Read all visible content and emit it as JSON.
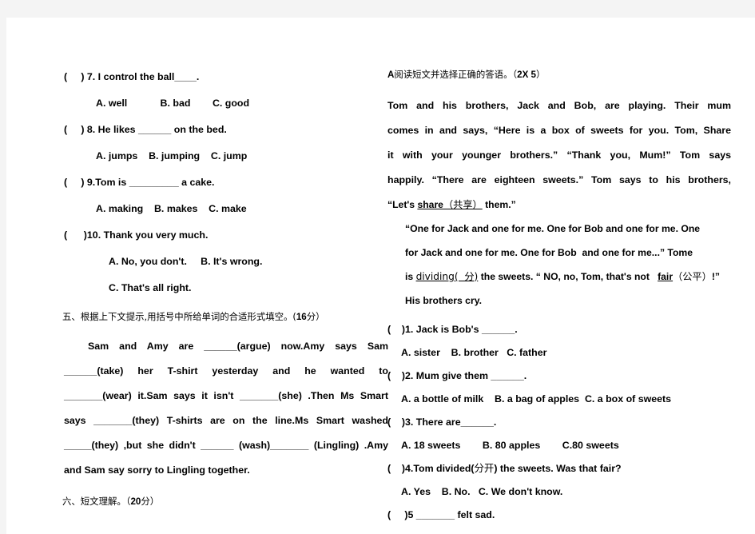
{
  "page": {
    "background": "#ffffff",
    "margin_color": "#f4f4f4"
  },
  "left_column": {
    "questions": [
      {
        "stem": "(     ) 7. I control the ball____.",
        "options": "A. well            B. bad        C. good"
      },
      {
        "stem": "(     ) 8. He likes ______ on the bed.",
        "options": "A. jumps    B. jumping    C. jump"
      },
      {
        "stem": "(     ) 9.Tom is _________ a cake.",
        "options": "A. making    B. makes    C. make"
      },
      {
        "stem": "(      )10. Thank you very much.",
        "options": "A. No, you don't.     B. It's wrong.",
        "options2": "C. That's all right."
      }
    ],
    "section_five": {
      "cn_prefix": "五、根据上下文提示,用括号中所给单词的合适形式填空。(",
      "score": "16",
      "cn_suffix": "分）"
    },
    "cloze_lines": [
      "Sam and Amy are ______(argue) now.Amy says Sam",
      "______(take) her T-shirt yesterday and he wanted to",
      "_______(wear) it.Sam says it isn't _______(she) .Then Ms Smart",
      "says _______(they) T-shirts are on the line.Ms Smart washed",
      "_____(they) ,but she didn't ______ (wash)_______ (Lingling) .Amy",
      "and Sam say sorry to Lingling together."
    ],
    "section_six": {
      "cn_prefix": "六、短文理解。（",
      "score": "20",
      "cn_suffix": "分）"
    }
  },
  "right_column": {
    "part_a_heading": {
      "letter": "A",
      "cn_text": "阅读短文并选择正确的答语。（",
      "score": "2X 5",
      "cn_suffix": "）"
    },
    "passage_lines": [
      "Tom and his brothers, Jack and Bob, are playing. Their mum",
      "comes in and says, “Here is a box of sweets for you. Tom, Share",
      "it with your younger brothers.” “Thank you, Mum!” Tom says",
      "happily. “There are eighteen sweets.” Tom says to his brothers,"
    ],
    "passage_share_line": {
      "before": "“Let's ",
      "underlined_word": "share",
      "underlined_cn": "（共享）",
      "after": " them.”"
    },
    "passage_indented_lines": [
      "“One for Jack and one for me. One for Bob and one for me. One",
      "for Jack and one for me. One for Bob  and one for me...” Tome"
    ],
    "passage_dividing_line": {
      "before": "is ",
      "underlined_word": "dividing(  分)",
      "middle": " the sweets. “ NO, no, Tom, that's not   ",
      "underlined_word2": "fair",
      "cn2": "（公平）",
      "after": "!”"
    },
    "passage_last_line": "His brothers cry.",
    "questions": [
      {
        "stem": "(    )1. Jack is Bob's ______.",
        "options": "A. sister    B. brother   C. father"
      },
      {
        "stem": "(    )2. Mum give them ______.",
        "options": "A. a bottle of milk    B. a bag of apples  C. a box of sweets"
      },
      {
        "stem": "(    )3. There are______.",
        "options": "A. 18 sweets        B. 80 apples        C.80 sweets"
      },
      {
        "stem_before": "(    )4.Tom divided(",
        "stem_cn": "分开",
        "stem_after": ") the sweets. Was that fair?",
        "options": "A. Yes    B. No.   C. We don't know."
      },
      {
        "stem": "(     )5 _______ felt sad.",
        "options": ""
      }
    ]
  }
}
